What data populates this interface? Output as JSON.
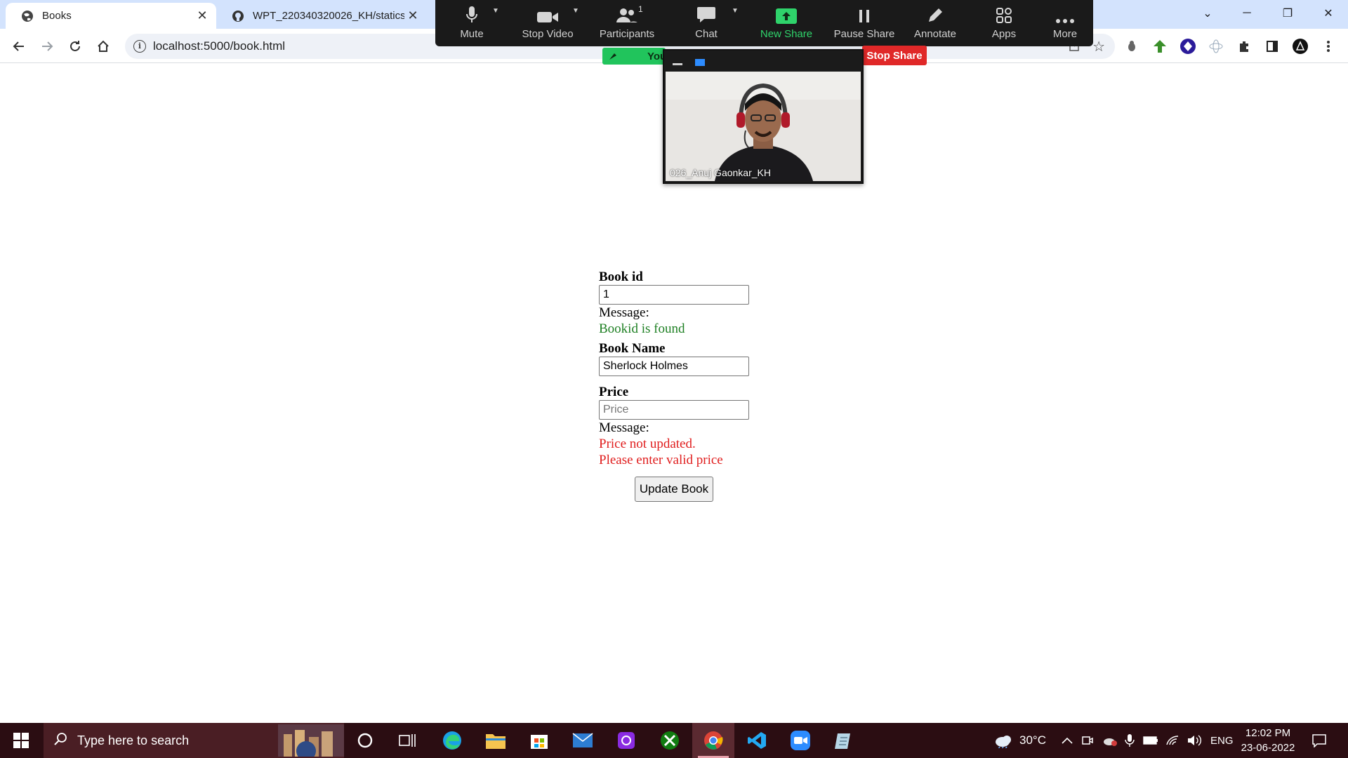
{
  "browser": {
    "tabs": [
      {
        "title": "Books",
        "icon": "globe-icon",
        "active": true
      },
      {
        "title": "WPT_220340320026_KH/statics",
        "icon": "github-icon",
        "active": false
      }
    ],
    "url": "localhost:5000/book.html"
  },
  "zoom": {
    "buttons": [
      {
        "label": "Mute",
        "icon": "microphone-icon"
      },
      {
        "label": "Stop Video",
        "icon": "video-camera-icon"
      },
      {
        "label": "Participants",
        "icon": "participants-icon",
        "count": "1"
      },
      {
        "label": "Chat",
        "icon": "chat-icon"
      },
      {
        "label": "New Share",
        "icon": "share-arrow-icon",
        "color": "#2fd36b"
      },
      {
        "label": "Pause Share",
        "icon": "pause-icon"
      },
      {
        "label": "Annotate",
        "icon": "pencil-icon"
      },
      {
        "label": "Apps",
        "icon": "apps-icon"
      },
      {
        "label": "More",
        "icon": "more-dots-icon"
      }
    ],
    "you_badge": "You",
    "stop_share": "Stop Share",
    "video_name": "026_Anuj Gaonkar_KH",
    "stop_share_color": "#e02828"
  },
  "form": {
    "bookid_label": "Book id",
    "bookid_value": "1",
    "bookid_message_label": "Message:",
    "bookid_message": "Bookid is found",
    "bookname_label": "Book Name",
    "bookname_value": "Sherlock Holmes",
    "price_label": "Price",
    "price_placeholder": "Price",
    "price_message_label": "Message:",
    "price_message_line1": "Price not updated.",
    "price_message_line2": "Please enter valid price",
    "submit_label": "Update Book",
    "success_color": "#1d7f22",
    "error_color": "#e01d1d"
  },
  "taskbar": {
    "search_placeholder": "Type here to search",
    "apps": [
      "edge-icon",
      "file-explorer-icon",
      "store-icon",
      "mail-icon",
      "app-icon",
      "xbox-icon",
      "chrome-icon",
      "vscode-icon",
      "zoom-icon",
      "notepad-icon"
    ],
    "weather": "30°C",
    "language": "ENG",
    "time": "12:02 PM",
    "date": "23-06-2022"
  }
}
